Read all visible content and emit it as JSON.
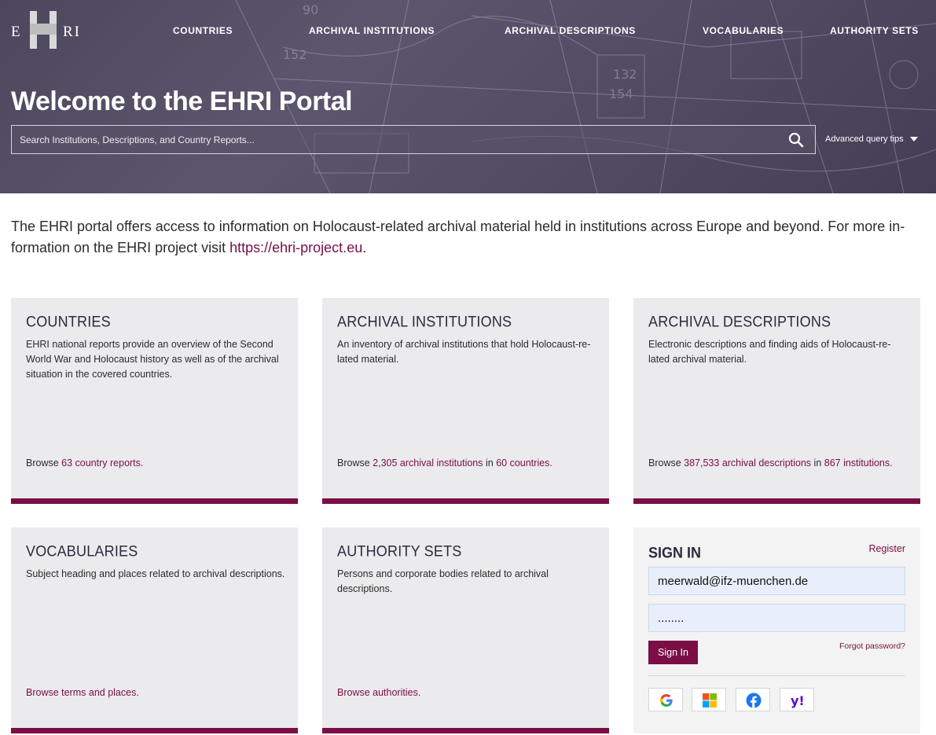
{
  "header": {
    "logo_left": "E",
    "logo_right": "RI",
    "nav": [
      {
        "label": "COUNTRIES"
      },
      {
        "label": "ARCHIVAL INSTITUTIONS"
      },
      {
        "label": "ARCHIVAL DESCRIPTIONS"
      },
      {
        "label": "VOCABULARIES"
      },
      {
        "label": "AUTHORITY SETS"
      }
    ],
    "title": "Welcome to the EHRI Portal",
    "search_placeholder": "Search Institutions, Descriptions, and Country Reports...",
    "advanced_tips": "Advanced query tips"
  },
  "intro": {
    "text": "The EHRI portal offers access to information on Holocaust-related archival material held in institutions across Europe and beyond. For more in­formation on the EHRI project visit ",
    "link": "https://ehri-project.eu",
    "end": "."
  },
  "cards": [
    {
      "title": "COUNTRIES",
      "desc": "EHRI national reports provide an overview of the Second World War and Holocaust history as well as of the archival situation in the covered countries.",
      "browse_prefix": "Browse ",
      "link1": "63 country reports.",
      "mid": "",
      "link2": ""
    },
    {
      "title": "ARCHIVAL INSTITUTIONS",
      "desc": "An inventory of archival institutions that hold Holocaust-re­lated material.",
      "browse_prefix": "Browse ",
      "link1": "2,305 archival institutions",
      "mid": " in ",
      "link2": "60 countries."
    },
    {
      "title": "ARCHIVAL DESCRIPTIONS",
      "desc": "Electronic descriptions and finding aids of Holocaust-re­lated archival material.",
      "browse_prefix": "Browse ",
      "link1": "387,533 archival descriptions",
      "mid": " in ",
      "link2": "867 institutions."
    },
    {
      "title": "VOCABULARIES",
      "desc": "Subject heading and places related to archival descriptions.",
      "browse_link": "Browse terms and places."
    },
    {
      "title": "AUTHORITY SETS",
      "desc": "Persons and corporate bodies related to archival descriptions.",
      "browse_link": "Browse authorities."
    }
  ],
  "signin": {
    "title": "SIGN IN",
    "register": "Register",
    "email_value": "meerwald@ifz-muenchen.de",
    "password_value": "........",
    "button": "Sign In",
    "forgot": "Forgot password?",
    "providers": [
      "google-icon",
      "microsoft-icon",
      "facebook-icon",
      "yahoo-icon"
    ]
  },
  "colors": {
    "accent": "#7a0e45",
    "hero": "#4d475e",
    "card_bg": "#ebebed"
  }
}
